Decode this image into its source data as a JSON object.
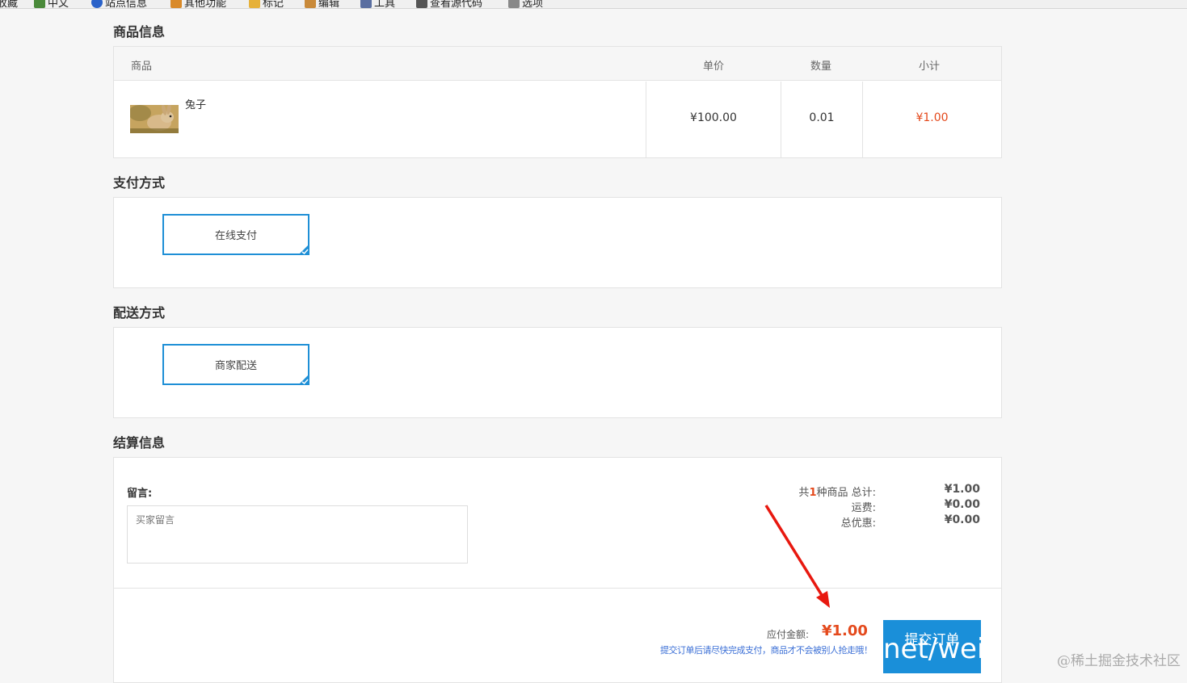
{
  "browser_bar": {
    "items": [
      "收藏",
      "中文",
      "站点信息",
      "其他功能",
      "标记",
      "编辑",
      "工具",
      "查看源代码",
      "选项"
    ]
  },
  "goods": {
    "title": "商品信息",
    "headers": {
      "product": "商品",
      "price": "单价",
      "qty": "数量",
      "subtotal": "小计"
    },
    "rows": [
      {
        "name": "兔子",
        "price": "¥100.00",
        "qty": "0.01",
        "subtotal": "¥1.00"
      }
    ]
  },
  "payment": {
    "title": "支付方式",
    "selected": "在线支付"
  },
  "delivery": {
    "title": "配送方式",
    "selected": "商家配送"
  },
  "settlement": {
    "title": "结算信息",
    "message_label": "留言:",
    "message_placeholder": "买家留言",
    "count_prefix": "共",
    "count": "1",
    "count_suffix": "种商品 总计:",
    "total_value": "¥1.00",
    "shipping_label": "运费:",
    "shipping_value": "¥0.00",
    "discount_label": "总优惠:",
    "discount_value": "¥0.00",
    "pay_label": "应付金额:",
    "pay_amount": "¥1.00",
    "submit_label": "提交订单",
    "note": "提交订单后请尽快完成支付，商品才不会被别人抢走哦！",
    "url_watermark": "net/wei"
  },
  "watermark": "@稀土掘金技术社区",
  "colors": {
    "accent": "#1a8fd9",
    "price_red": "#e4491c",
    "arrow": "#e8180f"
  },
  "icons": {
    "option_check": "checkmark-corner-icon",
    "arrow": "red-arrow-annotation"
  }
}
